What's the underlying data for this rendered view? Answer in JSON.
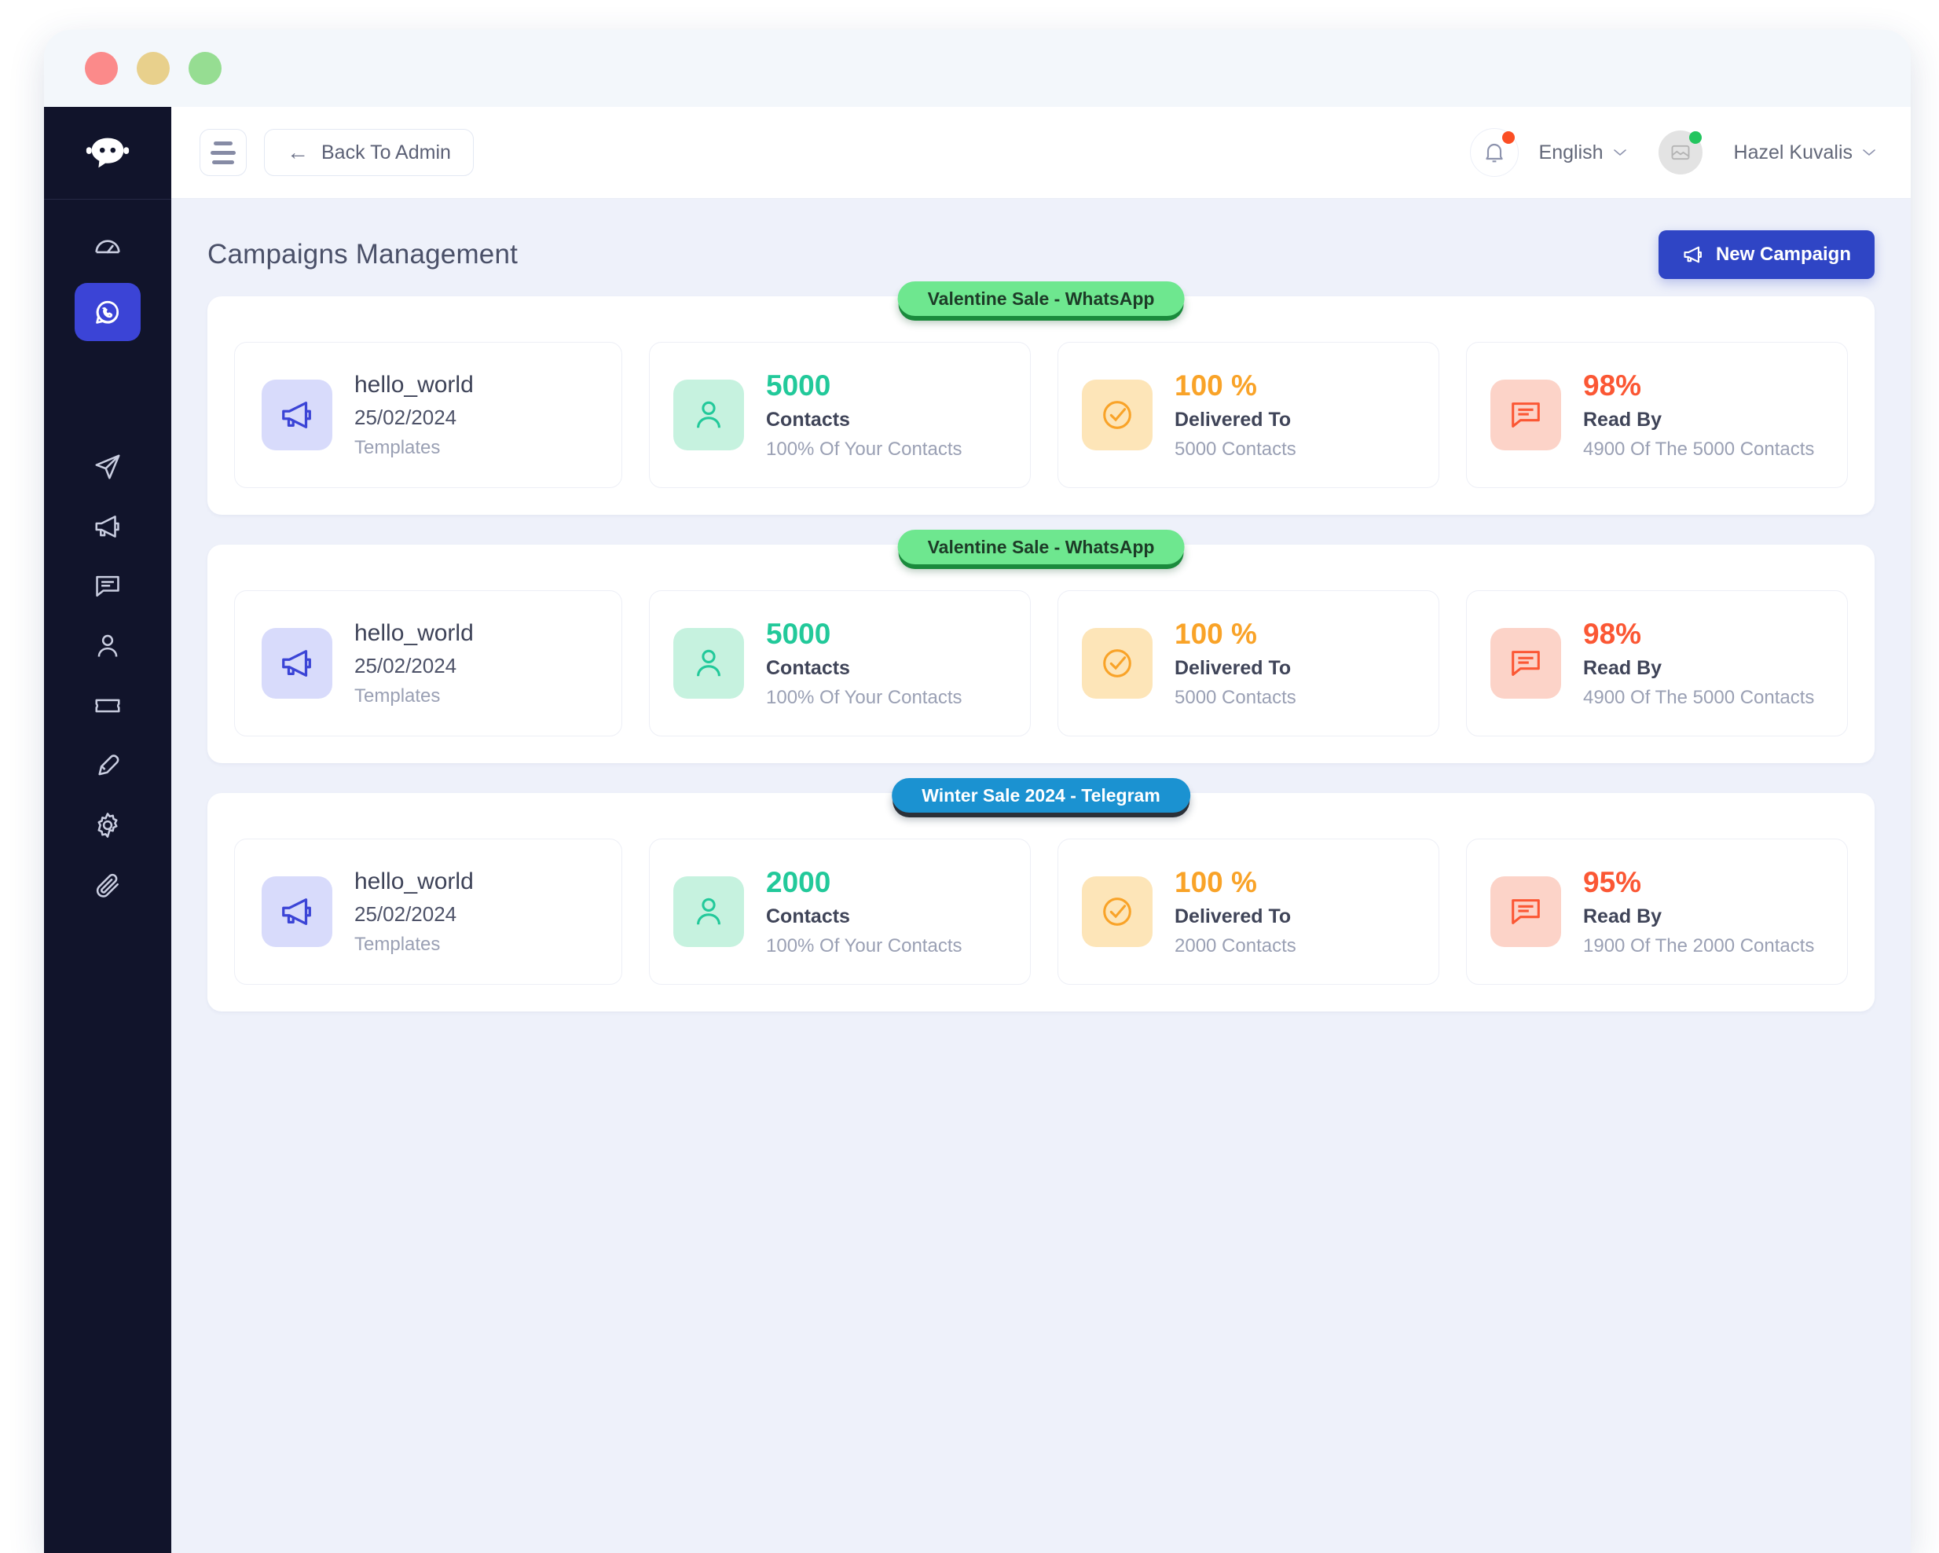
{
  "window": {
    "dots": [
      {
        "name": "close",
        "color": "#fb8a8a"
      },
      {
        "name": "minimize",
        "color": "#e8d08c"
      },
      {
        "name": "zoom",
        "color": "#96dd92"
      }
    ]
  },
  "sidebar": {
    "logo": "chatbot-logo",
    "top_items": [
      {
        "icon": "dashboard-gauge-icon",
        "active": false
      },
      {
        "icon": "whatsapp-icon",
        "active": true
      }
    ],
    "bottom_items": [
      {
        "icon": "send-plane-icon"
      },
      {
        "icon": "megaphone-icon"
      },
      {
        "icon": "chat-bubble-icon"
      },
      {
        "icon": "user-icon"
      },
      {
        "icon": "ticket-icon"
      },
      {
        "icon": "pen-edit-icon"
      },
      {
        "icon": "gear-icon"
      },
      {
        "icon": "paperclip-icon"
      }
    ]
  },
  "topbar": {
    "menu_icon": "hamburger-icon",
    "back_label": "Back To Admin",
    "back_arrow": "←",
    "notification_icon": "bell-icon",
    "has_notification": true,
    "language": "English",
    "user_name": "Hazel Kuvalis",
    "user_online": true
  },
  "page": {
    "title": "Campaigns Management",
    "new_campaign_label": "New Campaign"
  },
  "campaigns": [
    {
      "badge": "Valentine Sale - WhatsApp",
      "badge_type": "whatsapp",
      "template": {
        "name": "hello_world",
        "date": "25/02/2024",
        "sub": "Templates"
      },
      "stats": [
        {
          "value": "5000",
          "label": "Contacts",
          "sub": "100% Of Your Contacts",
          "tone": "mint",
          "icon": "user-icon"
        },
        {
          "value": "100 %",
          "label": "Delivered To",
          "sub": "5000 Contacts",
          "tone": "amber",
          "icon": "check-circle-icon"
        },
        {
          "value": "98%",
          "label": "Read By",
          "sub": "4900 Of The 5000 Contacts",
          "tone": "rose",
          "icon": "chat-bubble-icon"
        }
      ]
    },
    {
      "badge": "Valentine Sale - WhatsApp",
      "badge_type": "whatsapp",
      "template": {
        "name": "hello_world",
        "date": "25/02/2024",
        "sub": "Templates"
      },
      "stats": [
        {
          "value": "5000",
          "label": "Contacts",
          "sub": "100% Of Your Contacts",
          "tone": "mint",
          "icon": "user-icon"
        },
        {
          "value": "100 %",
          "label": "Delivered To",
          "sub": "5000 Contacts",
          "tone": "amber",
          "icon": "check-circle-icon"
        },
        {
          "value": "98%",
          "label": "Read By",
          "sub": "4900 Of The 5000 Contacts",
          "tone": "rose",
          "icon": "chat-bubble-icon"
        }
      ]
    },
    {
      "badge": "Winter Sale 2024 - Telegram",
      "badge_type": "telegram",
      "template": {
        "name": "hello_world",
        "date": "25/02/2024",
        "sub": "Templates"
      },
      "stats": [
        {
          "value": "2000",
          "label": "Contacts",
          "sub": "100% Of Your Contacts",
          "tone": "mint",
          "icon": "user-icon"
        },
        {
          "value": "100 %",
          "label": "Delivered To",
          "sub": "2000 Contacts",
          "tone": "amber",
          "icon": "check-circle-icon"
        },
        {
          "value": "95%",
          "label": "Read By",
          "sub": "1900 Of The 2000 Contacts",
          "tone": "rose",
          "icon": "chat-bubble-icon"
        }
      ]
    }
  ],
  "colors": {
    "accent_blue": "#2f45c5",
    "sidebar_bg": "#11142b",
    "page_bg": "#eef1fa",
    "mint": "#22c99a",
    "amber": "#f9a328",
    "rose": "#fb5734",
    "badge_green": "#6ee78f",
    "badge_blue": "#1b92d1"
  }
}
